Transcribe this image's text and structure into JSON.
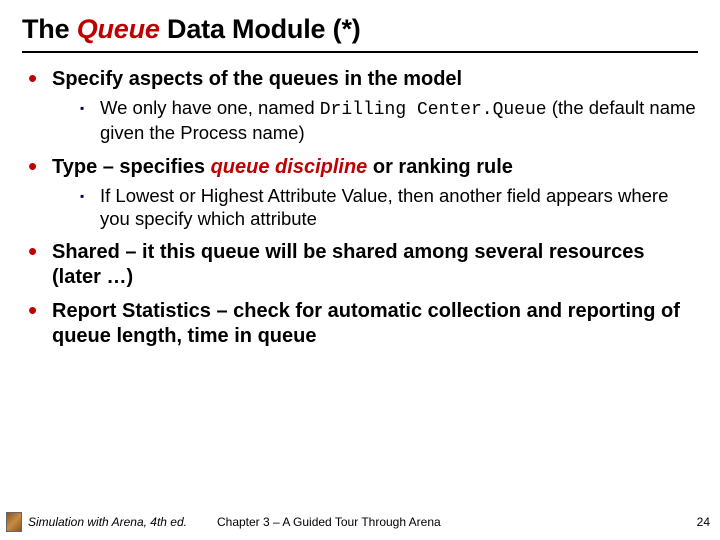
{
  "title": {
    "pre": "The ",
    "em": "Queue",
    "post": " Data Module (*)"
  },
  "bullets": [
    {
      "main_pre": "Specify aspects of the queues in the model",
      "main_em": "",
      "main_post": "",
      "subs": [
        {
          "pre": "We only have one, named ",
          "mono": "Drilling Center.Queue",
          "post": " (the default name given the Process name)"
        }
      ]
    },
    {
      "main_pre": "Type – specifies ",
      "main_em": "queue discipline",
      "main_post": " or ranking rule",
      "subs": [
        {
          "pre": "If Lowest or Highest Attribute Value, then another field appears where you specify which attribute",
          "mono": "",
          "post": ""
        }
      ]
    },
    {
      "main_pre": "Shared – it this queue will be shared among several resources (later …)",
      "main_em": "",
      "main_post": "",
      "subs": []
    },
    {
      "main_pre": "Report Statistics – check for automatic collection and reporting of queue length, time in queue",
      "main_em": "",
      "main_post": "",
      "subs": []
    }
  ],
  "footer": {
    "book": "Simulation with Arena, 4th ed.",
    "chapter": "Chapter 3 – A Guided Tour Through Arena",
    "page": "24"
  }
}
